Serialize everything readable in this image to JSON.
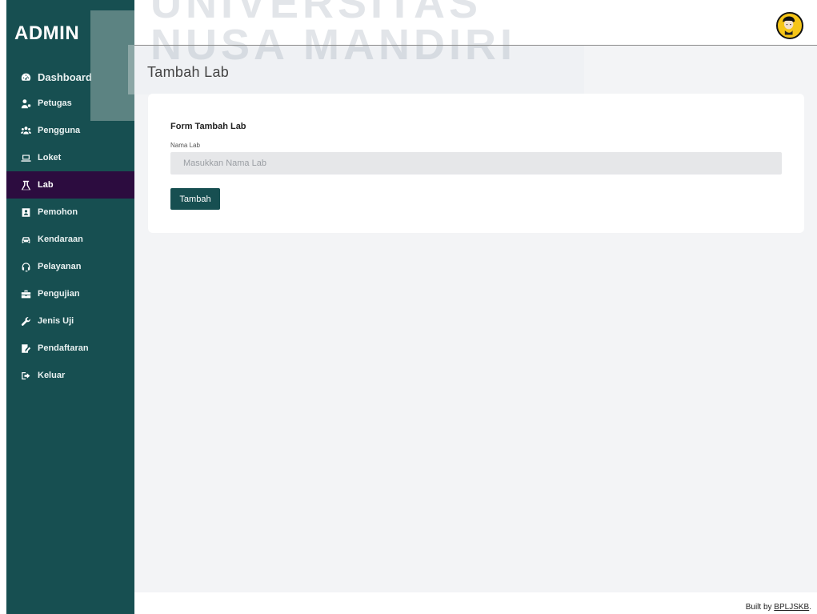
{
  "brand": {
    "title": "ADMIN"
  },
  "watermark": {
    "line1": "UNIVERSITAS",
    "line2": "NUSA MANDIRI"
  },
  "sidebar": {
    "items": [
      {
        "label": "Dashboard",
        "icon": "dashboard-icon"
      },
      {
        "label": "Petugas",
        "icon": "user-tie-icon"
      },
      {
        "label": "Pengguna",
        "icon": "users-icon"
      },
      {
        "label": "Loket",
        "icon": "laptop-icon"
      },
      {
        "label": "Lab",
        "icon": "flask-icon",
        "active": true
      },
      {
        "label": "Pemohon",
        "icon": "id-card-icon"
      },
      {
        "label": "Kendaraan",
        "icon": "car-icon"
      },
      {
        "label": "Pelayanan",
        "icon": "headset-icon"
      },
      {
        "label": "Pengujian",
        "icon": "toolbox-icon"
      },
      {
        "label": "Jenis Uji",
        "icon": "wrench-icon"
      },
      {
        "label": "Pendaftaran",
        "icon": "signature-icon"
      },
      {
        "label": "Keluar",
        "icon": "sign-out-icon"
      }
    ]
  },
  "page": {
    "title": "Tambah Lab"
  },
  "form": {
    "title": "Form Tambah Lab",
    "field_label": "Nama Lab",
    "field_placeholder": "Masukkan Nama Lab",
    "field_value": "",
    "submit_label": "Tambah"
  },
  "footer": {
    "prefix": "Built by ",
    "link": "BPLJSKB",
    "suffix": "."
  },
  "colors": {
    "sidebar_bg": "#174f51",
    "active_item_bg": "#2c0c3f",
    "main_bg": "#f3f4f6",
    "button_bg": "#174f51",
    "avatar_bg": "#f5c518"
  }
}
